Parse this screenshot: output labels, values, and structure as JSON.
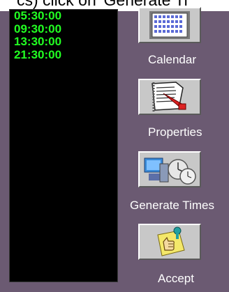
{
  "header_fragment": "cs) click on 'Generate Ti",
  "times": [
    "05:30:00",
    "09:30:00",
    "13:30:00",
    "21:30:00"
  ],
  "buttons": {
    "calendar": "Calendar",
    "properties": "Properties",
    "generate_times": "Generate Times",
    "accept": "Accept"
  },
  "colors": {
    "background": "#6b5a72",
    "list_background": "#000000",
    "time_text": "#22ff22"
  }
}
